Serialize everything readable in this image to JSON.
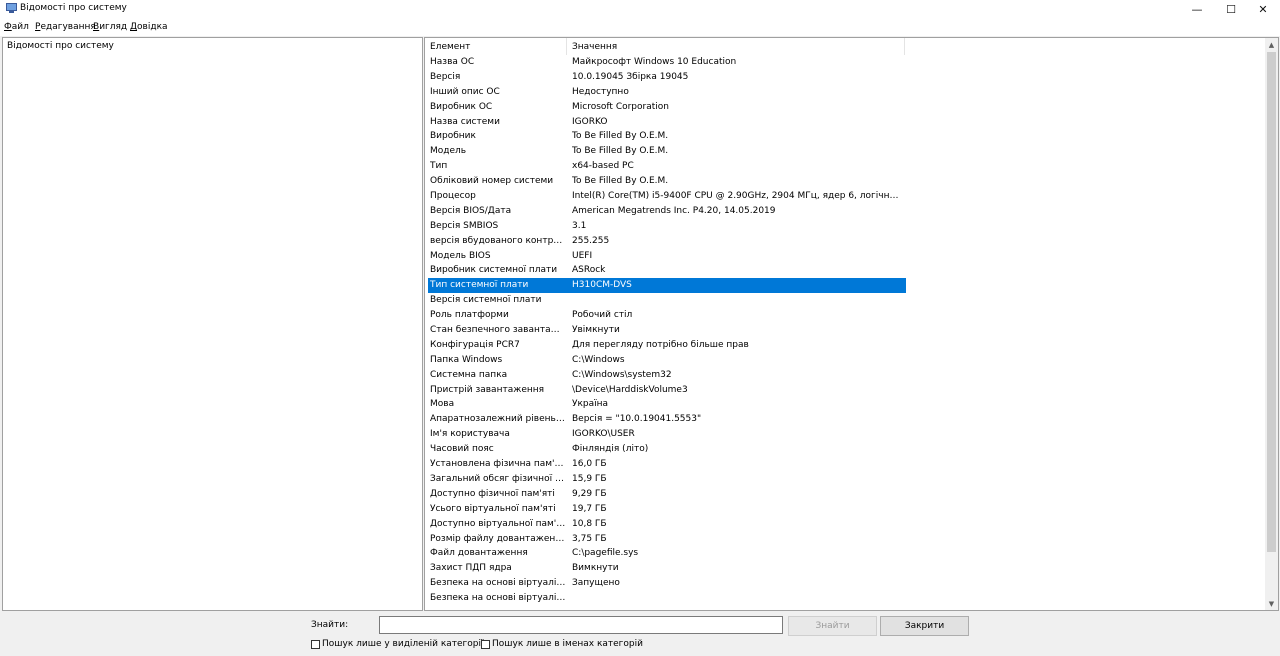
{
  "window": {
    "title": "Відомості про систему",
    "controls": {
      "minimize": "—",
      "maximize": "☐",
      "close": "✕"
    }
  },
  "menu": [
    {
      "label": "Файл",
      "ul": "Ф",
      "rest": "айл"
    },
    {
      "label": "Редагування",
      "ul": "Р",
      "rest": "едагування"
    },
    {
      "label": "Вигляд",
      "ul": "В",
      "rest": "игляд"
    },
    {
      "label": "Довідка",
      "ul": "Д",
      "rest": "овідка"
    }
  ],
  "tree": {
    "root": "Відомості про систему"
  },
  "table": {
    "columns": [
      "Елемент",
      "Значення"
    ],
    "selected_index": 15,
    "rows": [
      [
        "Назва ОС",
        "Майкрософт Windows 10 Education"
      ],
      [
        "Версія",
        "10.0.19045 Збірка 19045"
      ],
      [
        "Інший опис ОС",
        "Недоступно"
      ],
      [
        "Виробник ОС",
        "Microsoft Corporation"
      ],
      [
        "Назва системи",
        "IGORKO"
      ],
      [
        "Виробник",
        "To Be Filled By O.E.M."
      ],
      [
        "Модель",
        "To Be Filled By O.E.M."
      ],
      [
        "Тип",
        "x64-based PC"
      ],
      [
        "Обліковий номер системи",
        "To Be Filled By O.E.M."
      ],
      [
        "Процесор",
        "Intel(R) Core(TM) i5-9400F CPU @ 2.90GHz, 2904 МГц, ядер 6, логічних проц..."
      ],
      [
        "Версія BIOS/Дата",
        "American Megatrends Inc. P4.20, 14.05.2019"
      ],
      [
        "Версія SMBIOS",
        "3.1"
      ],
      [
        "версія вбудованого контроле...",
        "255.255"
      ],
      [
        "Модель BIOS",
        "UEFI"
      ],
      [
        "Виробник системної плати",
        "ASRock"
      ],
      [
        "Тип системної плати",
        "H310CM-DVS"
      ],
      [
        "Версія системної плати",
        ""
      ],
      [
        "Роль платформи",
        "Робочий стіл"
      ],
      [
        "Стан безпечного завантаження",
        "Увімкнути"
      ],
      [
        "Конфігурація PCR7",
        "Для перегляду потрібно більше прав"
      ],
      [
        "Папка Windows",
        "C:\\Windows"
      ],
      [
        "Системна папка",
        "C:\\Windows\\system32"
      ],
      [
        "Пристрій завантаження",
        "\\Device\\HarddiskVolume3"
      ],
      [
        "Мова",
        "Україна"
      ],
      [
        "Апаратнозалежний рівень (HAL)",
        "Версія = \"10.0.19041.5553\""
      ],
      [
        "Ім'я користувача",
        "IGORKO\\USER"
      ],
      [
        "Часовий пояс",
        "Фінляндія (літо)"
      ],
      [
        "Установлена фізична пам'ять (...",
        "16,0 ГБ"
      ],
      [
        "Загальний обсяг фізичної пам'...",
        "15,9 ГБ"
      ],
      [
        "Доступно фізичної пам'яті",
        "9,29 ГБ"
      ],
      [
        "Усього віртуальної пам'яті",
        "19,7 ГБ"
      ],
      [
        "Доступно віртуальної пам'яті",
        "10,8 ГБ"
      ],
      [
        "Розмір файлу довантаження",
        "3,75 ГБ"
      ],
      [
        "Файл довантаження",
        "C:\\pagefile.sys"
      ],
      [
        "Захист ПДП ядра",
        "Вимкнути"
      ],
      [
        "Безпека на основі віртуалізації",
        "Запущено"
      ],
      [
        "Безпека на основі віртуалізаці...",
        ""
      ]
    ]
  },
  "search": {
    "label": "Знайти:",
    "value": "",
    "find_button": "Знайти",
    "close_button": "Закрити",
    "option_selected_category": "Пошук лише у виділеній категорії",
    "option_category_names": "Пошук лише в іменах категорій"
  },
  "colors": {
    "selection": "#0078d7",
    "background": "#f0f0f0"
  }
}
